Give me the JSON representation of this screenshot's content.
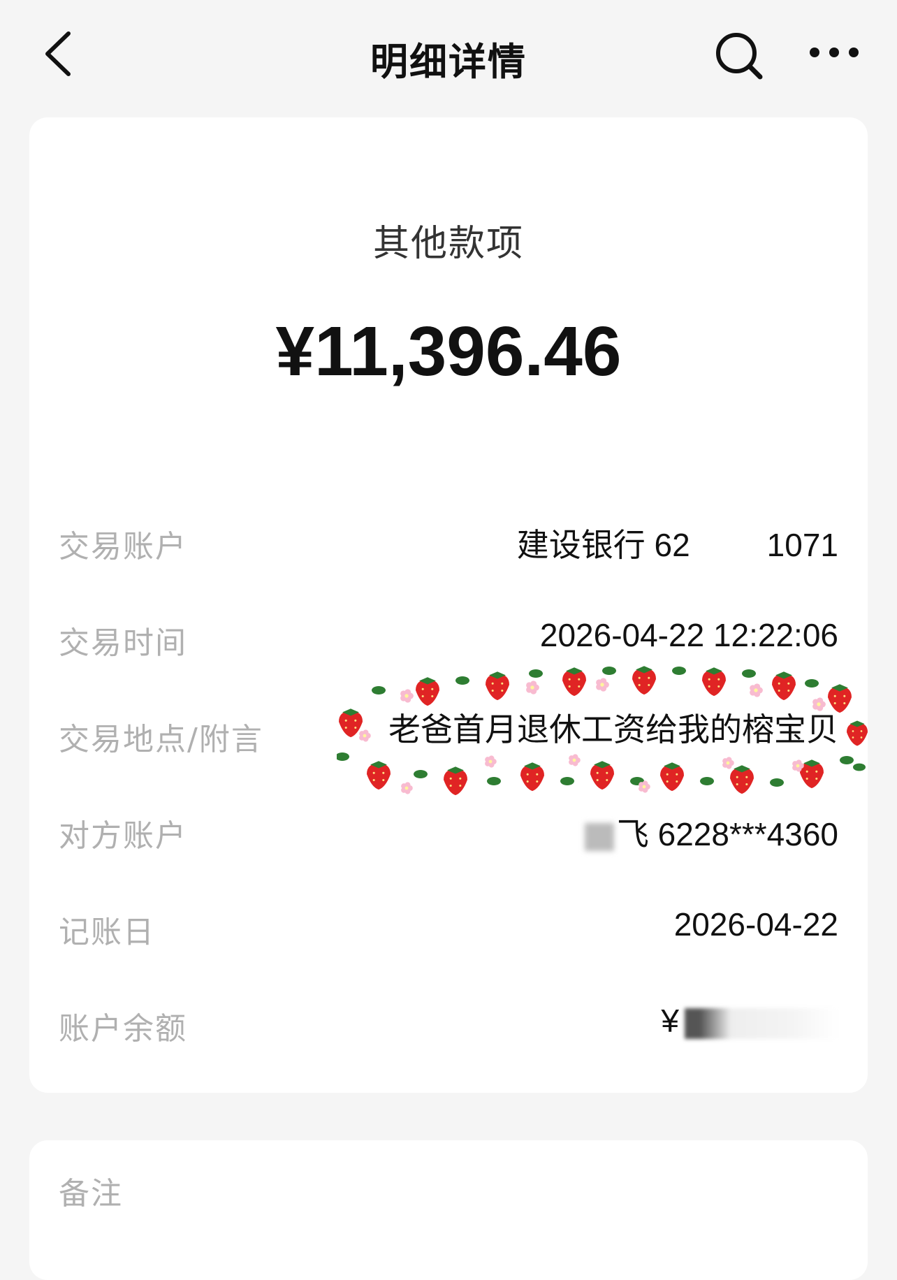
{
  "header": {
    "title": "明细详情",
    "back_icon": "chevron-left-icon",
    "search_icon": "search-icon",
    "more_icon": "more-dots-icon"
  },
  "summary": {
    "category": "其他款项",
    "amount": "¥11,396.46"
  },
  "details": {
    "account": {
      "label": "交易账户",
      "value_prefix": "建设银行 62",
      "value_suffix": "1071"
    },
    "time": {
      "label": "交易时间",
      "value": "2026-04-22 12:22:06"
    },
    "memo": {
      "label": "交易地点/附言",
      "value": "老爸首月退休工资给我的榕宝贝"
    },
    "counterparty": {
      "label": "对方账户",
      "value": "飞 6228***4360"
    },
    "posting_date": {
      "label": "记账日",
      "value": "2026-04-22"
    },
    "balance": {
      "label": "账户余额",
      "value_prefix": "¥"
    }
  },
  "remark": {
    "label": "备注"
  },
  "colors": {
    "background": "#f5f5f5",
    "card": "#ffffff",
    "label": "#b0b0b0",
    "text": "#111111",
    "strawberry": "#e02424",
    "leaf": "#2e7d32",
    "flower": "#f8bbd0"
  }
}
